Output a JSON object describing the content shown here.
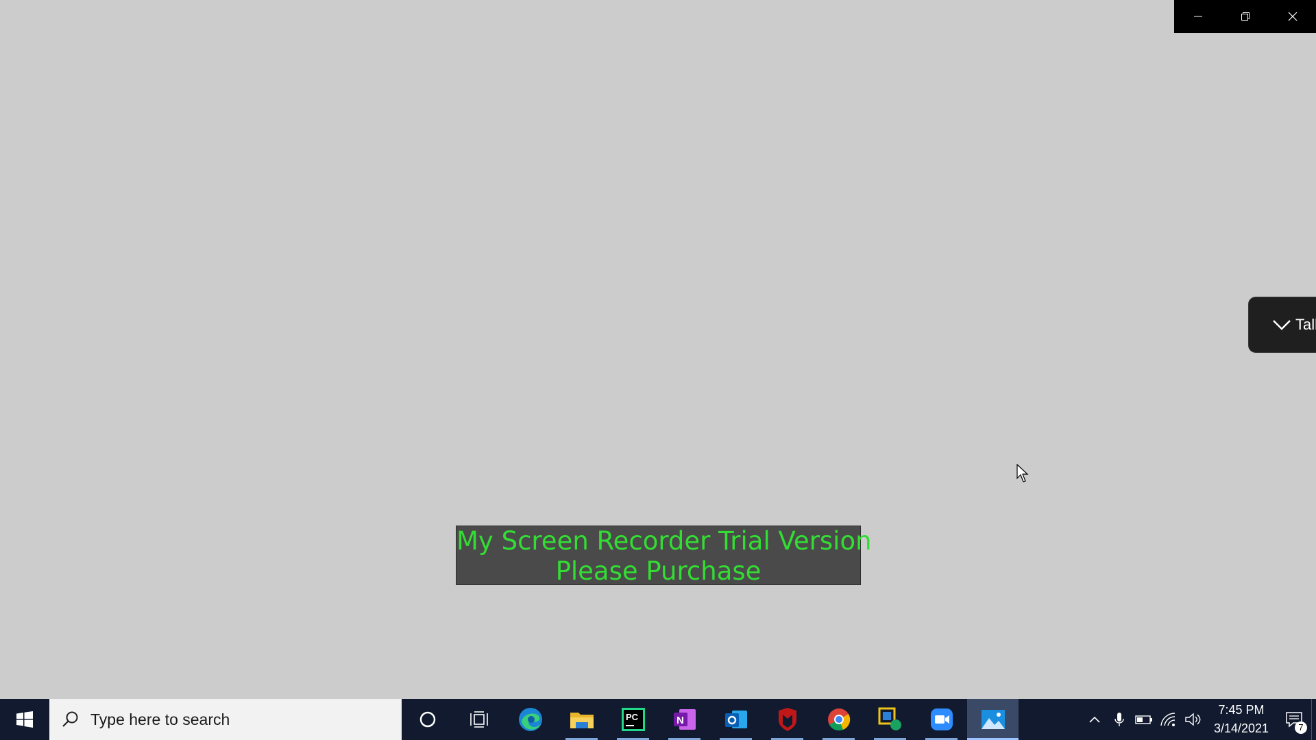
{
  "window": {
    "minimize_icon": "minimize-icon",
    "restore_icon": "restore-icon",
    "close_icon": "close-icon"
  },
  "talk_pill": {
    "label": "Talk"
  },
  "watermark": {
    "line1": "My Screen Recorder Trial Version",
    "line2": "Please Purchase"
  },
  "taskbar": {
    "search_placeholder": "Type here to search",
    "apps": [
      {
        "name": "Cortana",
        "icon": "cortana-icon"
      },
      {
        "name": "Task View",
        "icon": "task-view-icon"
      },
      {
        "name": "Microsoft Edge",
        "icon": "edge-icon"
      },
      {
        "name": "File Explorer",
        "icon": "folder-icon"
      },
      {
        "name": "PyCharm",
        "icon": "pycharm-icon"
      },
      {
        "name": "OneNote",
        "icon": "onenote-icon"
      },
      {
        "name": "Outlook",
        "icon": "outlook-icon"
      },
      {
        "name": "McAfee",
        "icon": "mcafee-icon"
      },
      {
        "name": "Google Chrome",
        "icon": "chrome-icon"
      },
      {
        "name": "Network App",
        "icon": "network-app-icon"
      },
      {
        "name": "Zoom",
        "icon": "zoom-icon"
      },
      {
        "name": "Photos",
        "icon": "photos-icon"
      }
    ],
    "tray": {
      "time": "7:45 PM",
      "date": "3/14/2021",
      "notification_count": "7"
    }
  },
  "colors": {
    "desktop": "#cccccc",
    "taskbar": "#111a2e",
    "watermark_text": "#33dd33"
  }
}
